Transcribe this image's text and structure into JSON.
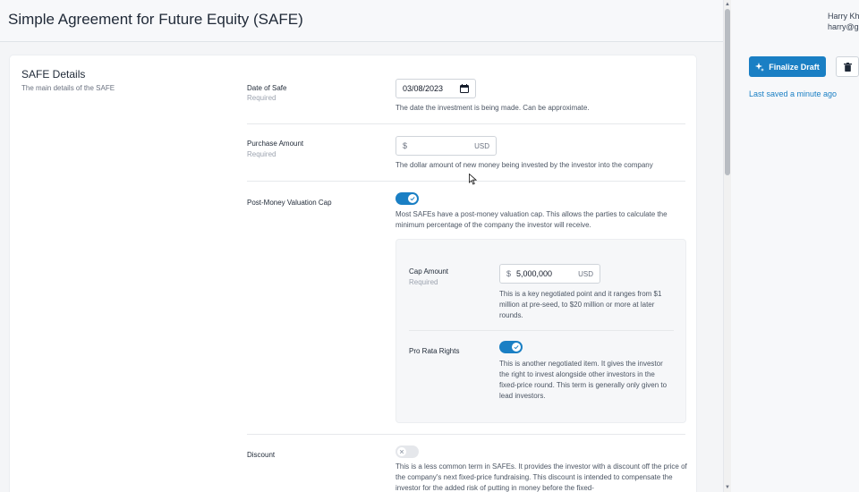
{
  "header": {
    "title": "Simple Agreement for Future Equity (SAFE)"
  },
  "user": {
    "name": "Harry Kh",
    "email": "harry@g"
  },
  "actions": {
    "finalize_label": "Finalize Draft",
    "last_saved": "Last saved a minute ago"
  },
  "section": {
    "title": "SAFE Details",
    "description": "The main details of the SAFE"
  },
  "fields": {
    "date": {
      "label": "Date of Safe",
      "sub": "Required",
      "value": "03/08/2023",
      "help": "The date the investment is being made. Can be approximate."
    },
    "purchase": {
      "label": "Purchase Amount",
      "sub": "Required",
      "currency_symbol": "$",
      "value": "",
      "currency": "USD",
      "help": "The dollar amount of new money being invested by the investor into the company"
    },
    "cap": {
      "label": "Post-Money Valuation Cap",
      "toggle": "on",
      "help": "Most SAFEs have a post-money valuation cap. This allows the parties to calculate the minimum percentage of the company the investor will receive."
    },
    "cap_amount": {
      "label": "Cap Amount",
      "sub": "Required",
      "currency_symbol": "$",
      "value": "5,000,000",
      "currency": "USD",
      "help": "This is a key negotiated point and it ranges from $1 million at pre-seed, to $20 million or more at later rounds."
    },
    "pro_rata": {
      "label": "Pro Rata Rights",
      "toggle": "on",
      "help": "This is another negotiated item. It gives the investor the right to invest alongside other investors in the fixed-price round. This term is generally only given to lead investors."
    },
    "discount": {
      "label": "Discount",
      "toggle": "off",
      "help": "This is a less common term in SAFEs. It provides the investor with a discount off the price of the company's next fixed-price fundraising. This discount is intended to compensate the investor for the added risk of putting in money before the fixed-"
    }
  },
  "colors": {
    "accent": "#1a7fc4",
    "background": "#f4f5f7",
    "card": "#ffffff"
  },
  "icons": [
    "sparkle-icon",
    "trash-icon",
    "calendar-icon",
    "check-icon",
    "x-icon",
    "cursor-icon"
  ]
}
